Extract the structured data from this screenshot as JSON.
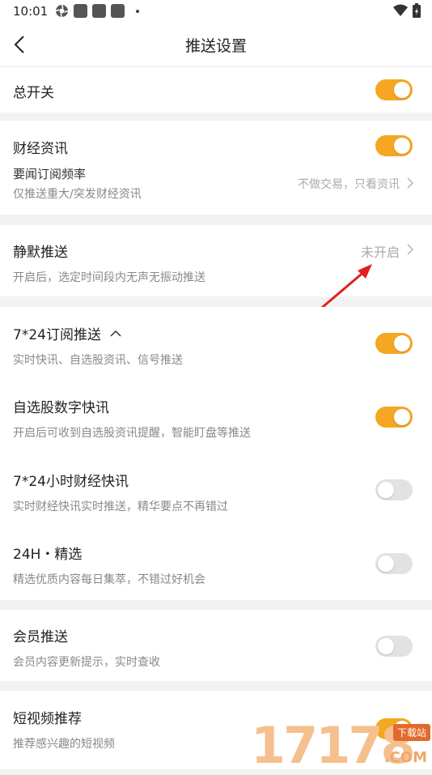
{
  "status_bar": {
    "time": "10:01"
  },
  "nav": {
    "title": "推送设置"
  },
  "master": {
    "label": "总开关",
    "on": true
  },
  "finance": {
    "label": "财经资讯",
    "on": true,
    "freq_label": "要闻订阅频率",
    "freq_desc": "仅推送重大/突发财经资讯",
    "freq_value": "不做交易，只看资讯"
  },
  "silent": {
    "label": "静默推送",
    "desc": "开启后，选定时间段内无声无振动推送",
    "value": "未开启"
  },
  "subscriptions": [
    {
      "label": "7*24订阅推送",
      "desc": "实时快讯、自选股资讯、信号推送",
      "on": true
    },
    {
      "label": "自选股数字快讯",
      "desc": "开启后可收到自选股资讯提醒，智能盯盘等推送",
      "on": true
    },
    {
      "label": "7*24小时财经快讯",
      "desc": "实时财经快讯实时推送，精华要点不再错过",
      "on": false
    },
    {
      "label": "24H・精选",
      "desc": "精选优质内容每日集萃，不错过好机会",
      "on": false
    }
  ],
  "member": {
    "label": "会员推送",
    "desc": "会员内容更新提示，实时查收",
    "on": false
  },
  "video": {
    "label": "短视频推荐",
    "desc": "推荐感兴趣的短视频",
    "on": true
  },
  "watermark": {
    "digits": "17178",
    "badge": "下载站",
    "com": ".COM"
  },
  "colors": {
    "accent": "#f5a623",
    "toggle_off": "#e2e2e2",
    "arrow": "#e02020"
  },
  "icons": {
    "back": "back-arrow-icon",
    "chevron": "chevron-right-icon",
    "expand": "chevron-up-icon"
  }
}
